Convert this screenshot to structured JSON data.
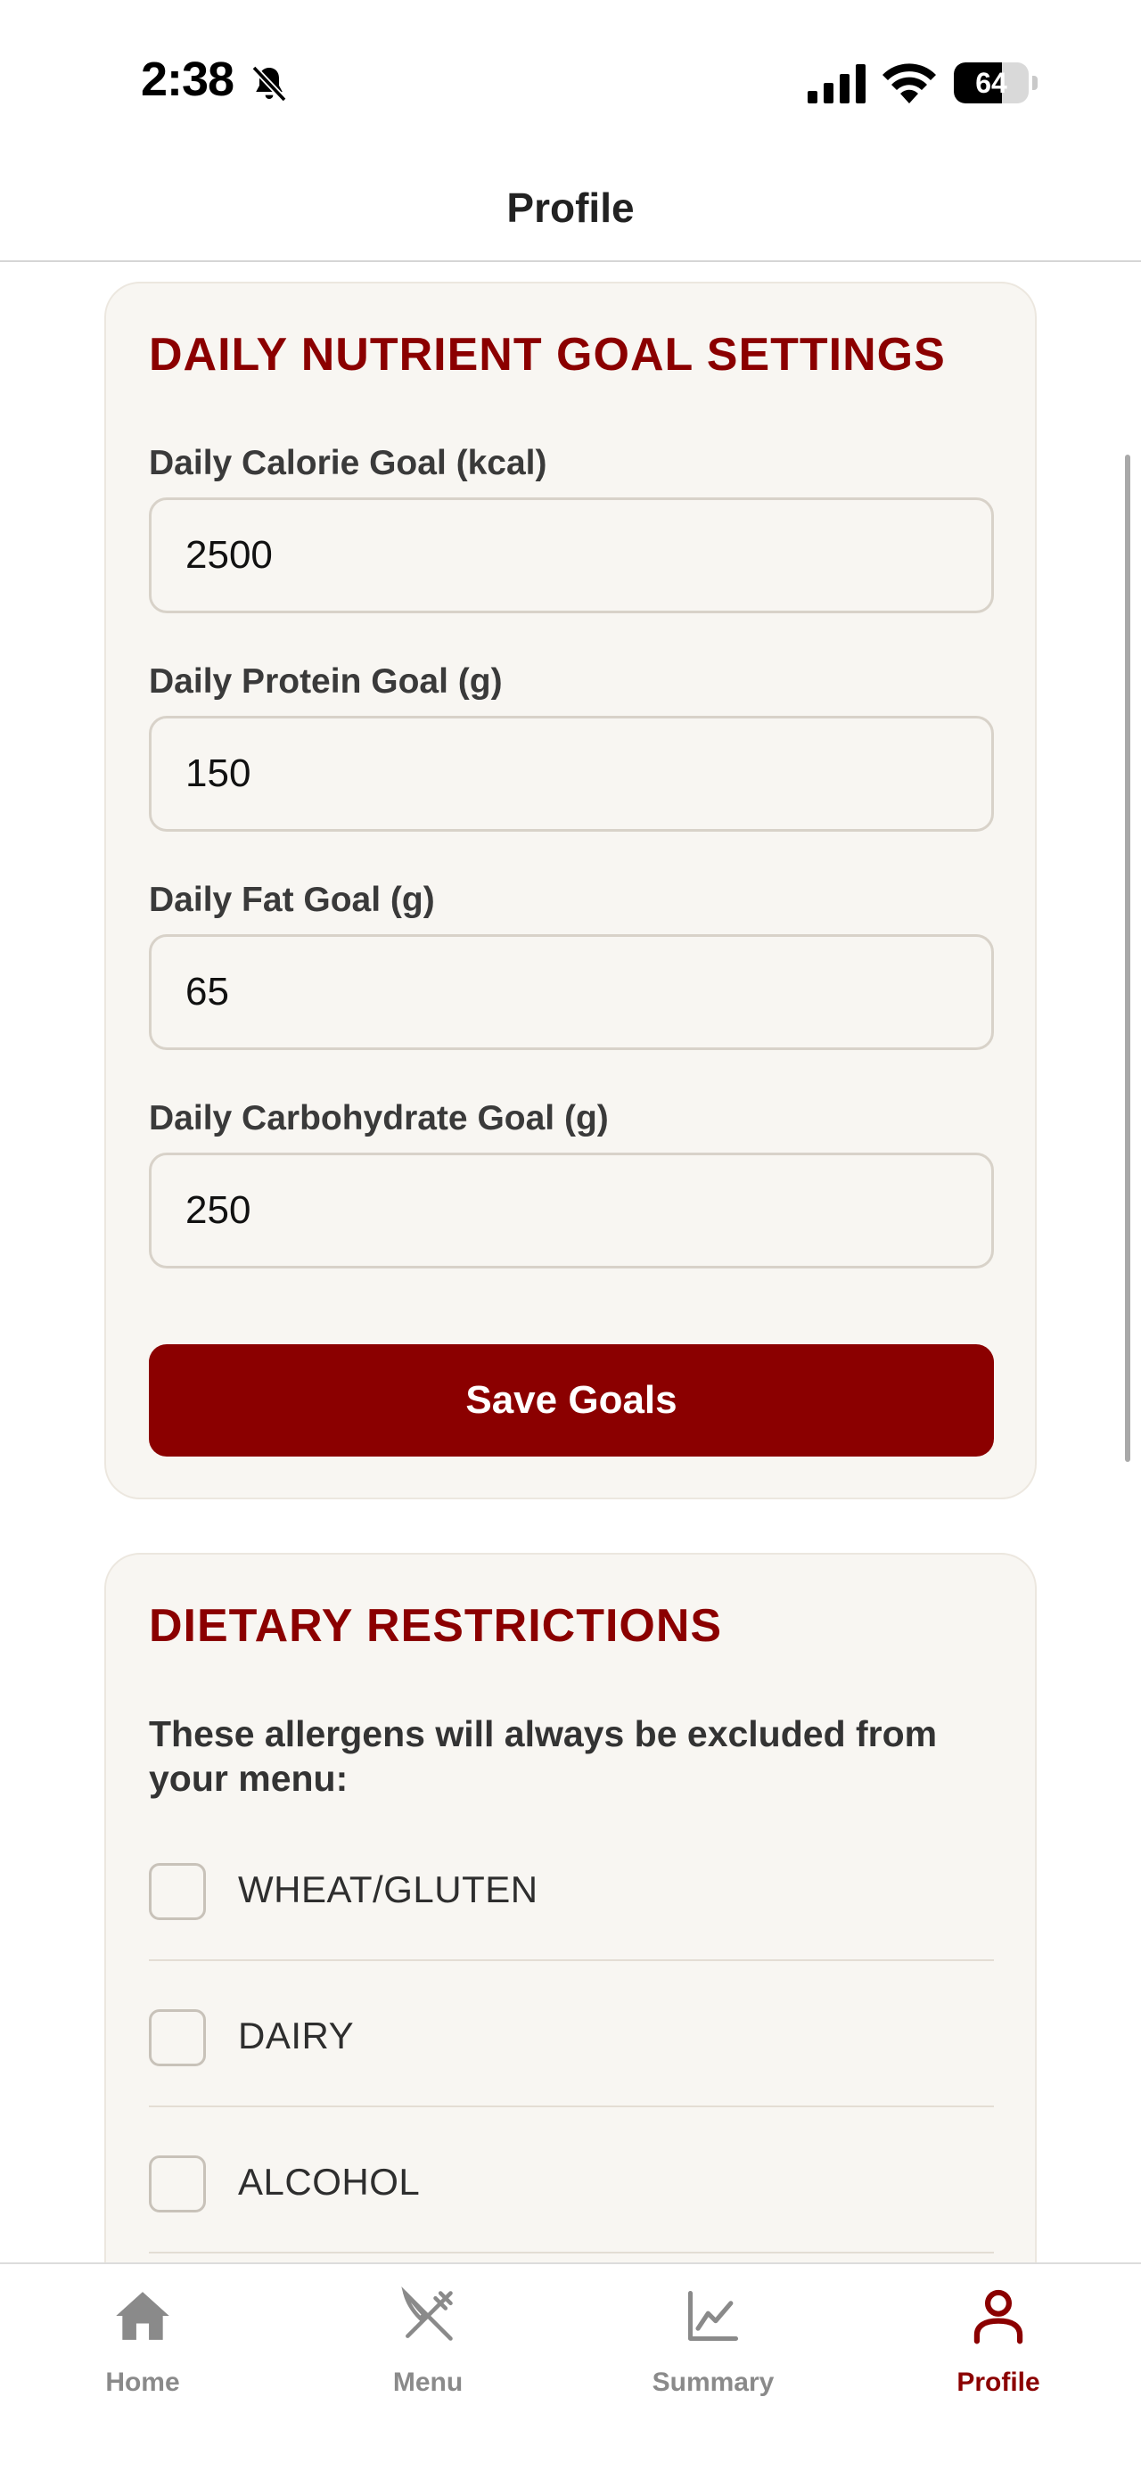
{
  "status_bar": {
    "time": "2:38",
    "battery": "64",
    "battery_level": 0.64
  },
  "header": {
    "title": "Profile"
  },
  "goals_card": {
    "title": "DAILY NUTRIENT GOAL SETTINGS",
    "fields": [
      {
        "label": "Daily Calorie Goal (kcal)",
        "value": "2500"
      },
      {
        "label": "Daily Protein Goal (g)",
        "value": "150"
      },
      {
        "label": "Daily Fat Goal (g)",
        "value": "65"
      },
      {
        "label": "Daily Carbohydrate Goal (g)",
        "value": "250"
      }
    ],
    "save_label": "Save Goals"
  },
  "diet_card": {
    "title": "DIETARY RESTRICTIONS",
    "description": "These allergens will always be excluded from your menu:",
    "allergens": [
      {
        "label": "WHEAT/GLUTEN",
        "checked": false
      },
      {
        "label": "DAIRY",
        "checked": false
      },
      {
        "label": "ALCOHOL",
        "checked": false
      }
    ]
  },
  "tabs": [
    {
      "label": "Home",
      "icon": "home-icon",
      "active": false
    },
    {
      "label": "Menu",
      "icon": "fork-knife-icon",
      "active": false
    },
    {
      "label": "Summary",
      "icon": "chart-icon",
      "active": false
    },
    {
      "label": "Profile",
      "icon": "person-icon",
      "active": true
    }
  ],
  "colors": {
    "accent": "#8b0000",
    "card_bg": "#f8f6f2",
    "inactive": "#8a8a8a"
  }
}
